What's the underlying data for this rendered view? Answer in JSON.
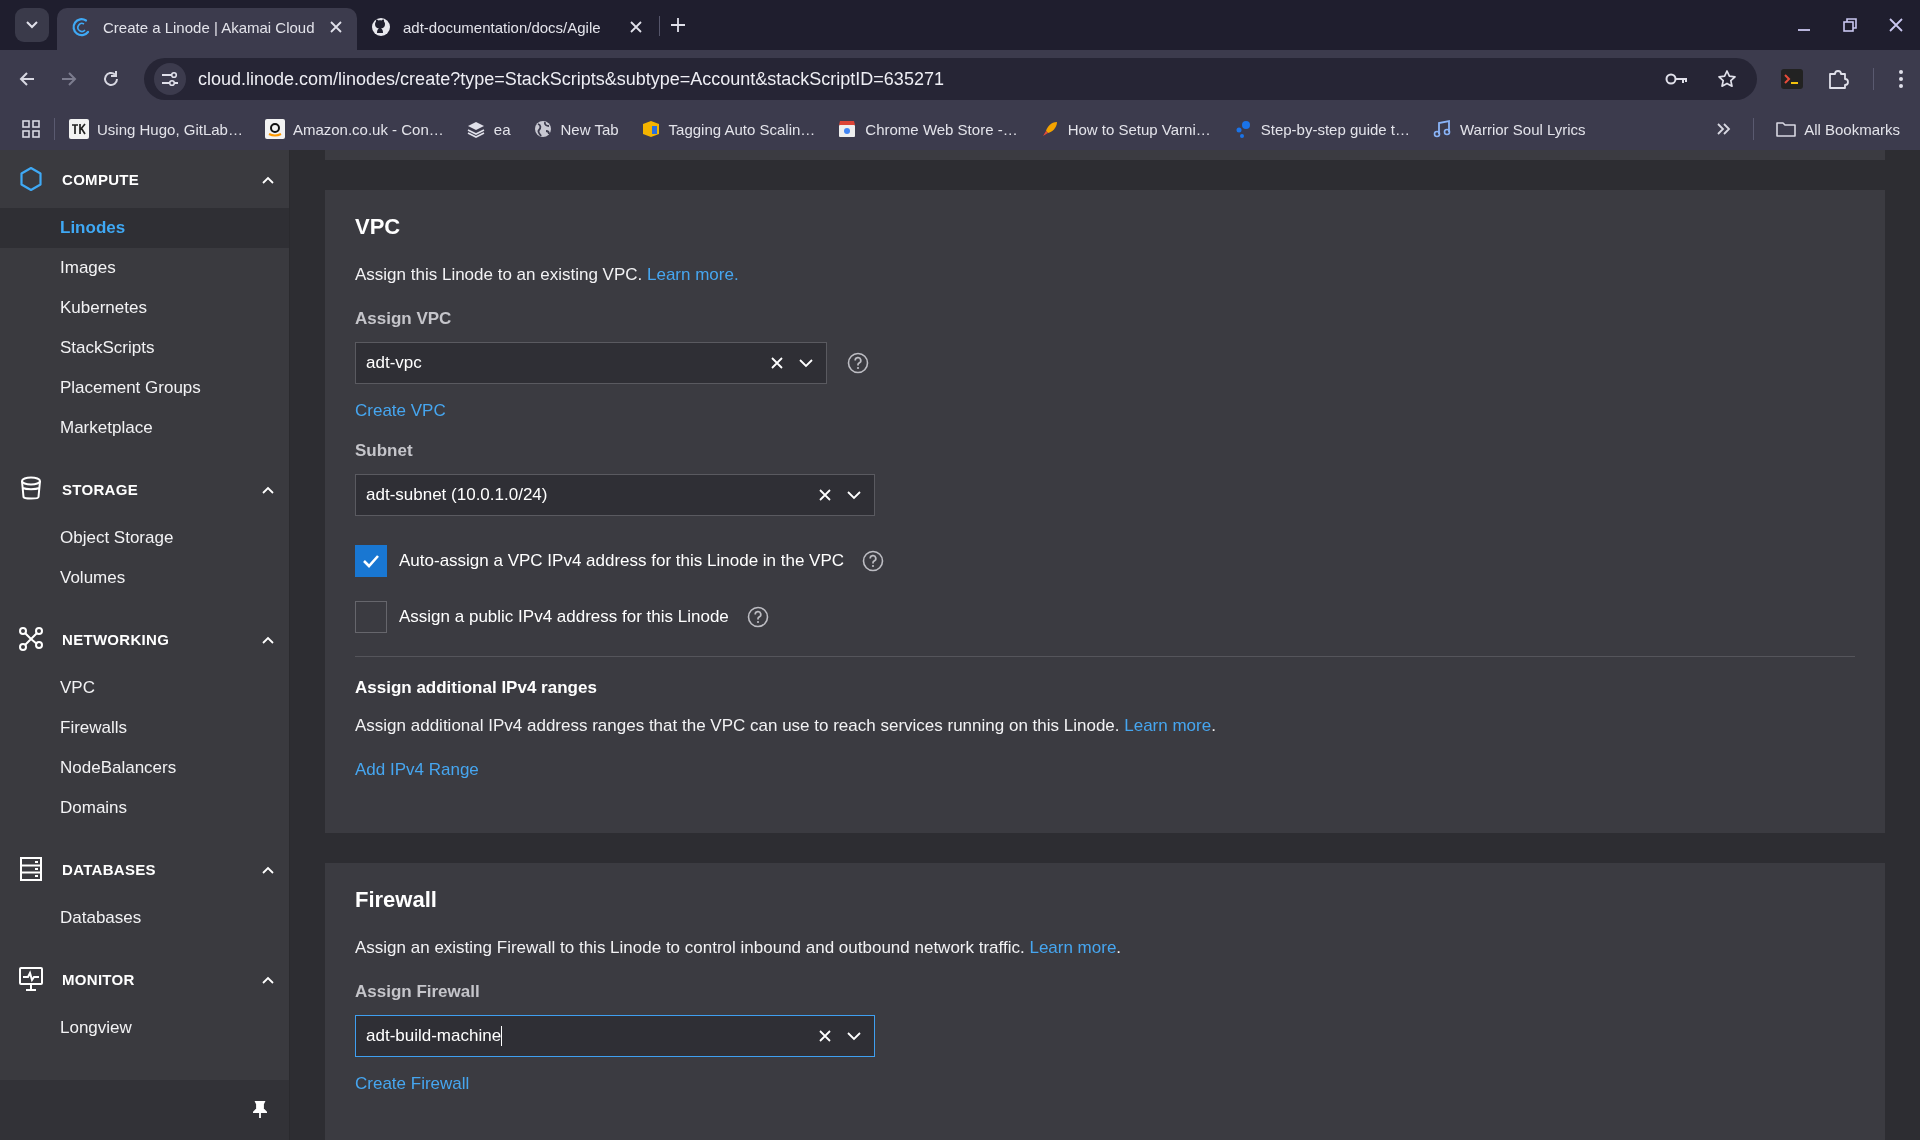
{
  "browser": {
    "tabs": [
      {
        "title": "Create a Linode | Akamai Cloud",
        "selected": true
      },
      {
        "title": "adt-documentation/docs/Agile",
        "selected": false
      }
    ],
    "url": "cloud.linode.com/linodes/create?type=StackScripts&subtype=Account&stackScriptID=635271",
    "bookmarks": [
      {
        "label": "Using Hugo, GitLab…"
      },
      {
        "label": "Amazon.co.uk - Con…"
      },
      {
        "label": "ea"
      },
      {
        "label": "New Tab"
      },
      {
        "label": "Tagging Auto Scalin…"
      },
      {
        "label": "Chrome Web Store -…"
      },
      {
        "label": "How to Setup Varni…"
      },
      {
        "label": "Step-by-step guide t…"
      },
      {
        "label": "Warrior Soul Lyrics"
      }
    ],
    "all_bookmarks": "All Bookmarks"
  },
  "sidebar": {
    "sections": [
      {
        "title": "COMPUTE",
        "expanded": true,
        "items": [
          {
            "label": "Linodes",
            "selected": true
          },
          {
            "label": "Images",
            "selected": false
          },
          {
            "label": "Kubernetes",
            "selected": false
          },
          {
            "label": "StackScripts",
            "selected": false
          },
          {
            "label": "Placement Groups",
            "selected": false
          },
          {
            "label": "Marketplace",
            "selected": false
          }
        ]
      },
      {
        "title": "STORAGE",
        "expanded": true,
        "items": [
          {
            "label": "Object Storage",
            "selected": false
          },
          {
            "label": "Volumes",
            "selected": false
          }
        ]
      },
      {
        "title": "NETWORKING",
        "expanded": true,
        "items": [
          {
            "label": "VPC",
            "selected": false
          },
          {
            "label": "Firewalls",
            "selected": false
          },
          {
            "label": "NodeBalancers",
            "selected": false
          },
          {
            "label": "Domains",
            "selected": false
          }
        ]
      },
      {
        "title": "DATABASES",
        "expanded": true,
        "items": [
          {
            "label": "Databases",
            "selected": false
          }
        ]
      },
      {
        "title": "MONITOR",
        "expanded": true,
        "items": [
          {
            "label": "Longview",
            "selected": false
          }
        ]
      }
    ]
  },
  "cards": [
    {
      "title": "VPC",
      "blocks": [
        {
          "kind": "description",
          "text": "Assign this Linode to an existing VPC.",
          "link": "Learn more."
        },
        {
          "kind": "select",
          "label": "Assign VPC",
          "value": "adt-vpc",
          "help": true,
          "focused": false
        },
        {
          "kind": "link",
          "text": "Create VPC"
        },
        {
          "kind": "select",
          "label": "Subnet",
          "value": "adt-subnet (10.0.1.0/24)",
          "help": false,
          "focused": false
        },
        {
          "kind": "checkbox",
          "label": "Auto-assign a VPC IPv4 address for this Linode in the VPC",
          "checked": true,
          "help": true
        },
        {
          "kind": "checkbox",
          "label": "Assign a public IPv4 address for this Linode",
          "checked": false,
          "help": true
        },
        {
          "kind": "divider"
        },
        {
          "kind": "subheading",
          "text": "Assign additional IPv4 ranges"
        },
        {
          "kind": "description",
          "text": "Assign additional IPv4 address ranges that the VPC can use to reach services running on this Linode.",
          "link": "Learn more",
          "end": "."
        },
        {
          "kind": "link",
          "text": "Add IPv4 Range"
        }
      ]
    },
    {
      "title": "Firewall",
      "blocks": [
        {
          "kind": "description",
          "text": "Assign an existing Firewall to this Linode to control inbound and outbound network traffic.",
          "link": "Learn more",
          "end": "."
        },
        {
          "kind": "select",
          "label": "Assign Firewall",
          "value": "adt-build-machine",
          "help": false,
          "focused": true
        },
        {
          "kind": "link",
          "text": "Create Firewall"
        }
      ]
    }
  ]
}
